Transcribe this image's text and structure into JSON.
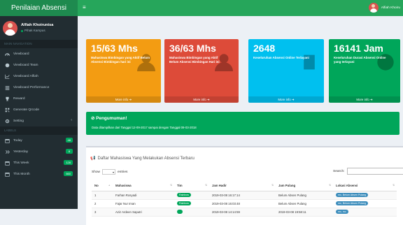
{
  "app": {
    "logo": "Penilaian Absensi"
  },
  "user": {
    "name": "Alfiah Khoirunisa",
    "status": "Pihak Kampus",
    "top_name": "Alfiah Khoiru"
  },
  "sidebar": {
    "header_main": "MAIN NAVIGATION",
    "items": [
      {
        "label": "Viewboard",
        "icon": "dashboard-icon"
      },
      {
        "label": "Viewboard Team",
        "icon": "users-icon"
      },
      {
        "label": "Viewboard Alfiah",
        "icon": "chart-icon"
      },
      {
        "label": "Viewboard Performance",
        "icon": "performance-icon"
      },
      {
        "label": "Reward",
        "icon": "trophy-icon"
      },
      {
        "label": "Generate Qrcode",
        "icon": "qrcode-icon"
      },
      {
        "label": "Setting",
        "icon": "gear-icon"
      }
    ],
    "header_label": "LABELS",
    "labels": [
      {
        "label": "Today",
        "badge": "48",
        "icon": "calendar-icon"
      },
      {
        "label": "Yesterday",
        "badge": "8",
        "icon": "history-icon"
      },
      {
        "label": "This Week",
        "badge": "128",
        "icon": "calendar-week-icon"
      },
      {
        "label": "This Month",
        "badge": "660",
        "icon": "calendar-month-icon"
      }
    ]
  },
  "stats": [
    {
      "value": "15/63 Mhs",
      "desc": "Mahasiswa Bimbingan yang Aktif Belum Absensi Bimbingan hari ini",
      "more": "More info",
      "color": "#f39c12"
    },
    {
      "value": "36/63 Mhs",
      "desc": "Mahasiswa Bimbingan yang Aktif Belum Absensi Bimbingan Hari ini",
      "more": "More info",
      "color": "#dd4b39"
    },
    {
      "value": "2648",
      "desc": "Keseluruhan Absensi Online Terlayani",
      "more": "More info",
      "color": "#00c0ef"
    },
    {
      "value": "16141 Jam",
      "desc": "Keseluruhan Durasi Absensi Online yang terlayani",
      "more": "More info",
      "color": "#00a65a"
    }
  ],
  "announcement": {
    "title": "Pengumuman!",
    "text": "Data ditampilkan dari Tanggal 12-09-2017 sampai dengan Tanggal 09-03-2018"
  },
  "table": {
    "title": "Daftar Mahasiswa Yang Melakukan Absensi Terbaru",
    "show_label": "Show",
    "entries_label": "entries",
    "show_value": "10",
    "search_label": "Search:",
    "columns": [
      "No",
      "Mahasiswa",
      "Tim",
      "Jam Hadir",
      "Jam Pulang",
      "Lokasi Absensi"
    ],
    "rows": [
      [
        "1",
        "Farhan Rosyadi",
        "Rainbow",
        "2019-03-08 16:17:14",
        "Belum Absen Pulang",
        "mc, Belum Absen Pulang"
      ],
      [
        "2",
        "Fajar Nur Iman",
        "Rainbow",
        "2019-03-08 16:03:48",
        "Belum Absen Pulang",
        "mc, Belum Absen Pulang"
      ],
      [
        "3",
        "Aziz Ardeen Saputri",
        "",
        "2019-03-08 14:14:59",
        "2019-03-08 19:58:11",
        "mc, mc"
      ]
    ]
  }
}
